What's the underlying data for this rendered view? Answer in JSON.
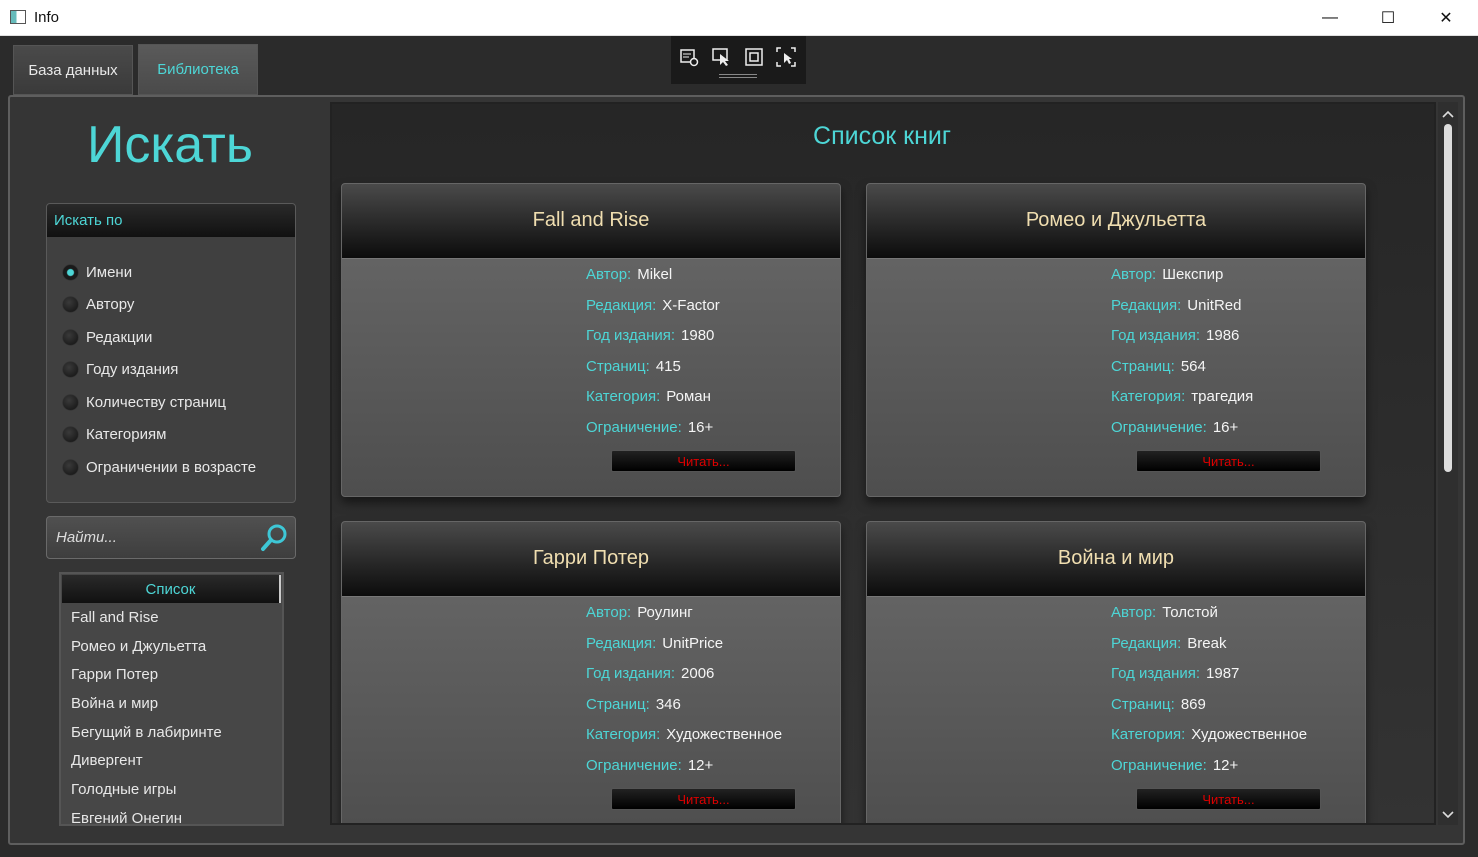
{
  "window": {
    "title": "Info",
    "minimize_glyph": "—",
    "maximize_glyph": "☐",
    "close_glyph": "✕"
  },
  "tabs": [
    {
      "label": "База данных"
    },
    {
      "label": "Библиотека"
    }
  ],
  "debug_toolbar": {
    "icons": [
      "live-tree-icon",
      "select-element-icon",
      "display-layout-adorners-icon",
      "track-focus-icon"
    ]
  },
  "search": {
    "title": "Искать",
    "by_header": "Искать по",
    "options": [
      "Имени",
      "Автору",
      "Редакции",
      "Году издания",
      "Количеству страниц",
      "Категориям",
      "Ограничении в возрасте"
    ],
    "selected_index": 0,
    "placeholder": "Найти..."
  },
  "list": {
    "header": "Список",
    "items": [
      "Fall and Rise",
      "Ромео и Джульетта",
      "Гарри Потер",
      "Война и мир",
      "Бегущий в лабиринте",
      "Дивергент",
      "Голодные игры",
      "Евгений Онегин"
    ]
  },
  "content": {
    "title": "Список книг",
    "field_labels": {
      "author": "Автор:",
      "publisher": "Редакция:",
      "year": "Год издания:",
      "pages": "Страниц:",
      "category": "Категория:",
      "age": "Ограничение:"
    },
    "read_label": "Читать...",
    "books": [
      {
        "title": "Fall and Rise",
        "author": "Mikel",
        "publisher": "X-Factor",
        "year": "1980",
        "pages": "415",
        "category": "Роман",
        "age": "16+"
      },
      {
        "title": "Ромео и Джульетта",
        "author": "Шекспир",
        "publisher": "UnitRed",
        "year": "1986",
        "pages": "564",
        "category": "трагедия",
        "age": "16+"
      },
      {
        "title": "Гарри Потер",
        "author": "Роулинг",
        "publisher": "UnitPrice",
        "year": "2006",
        "pages": "346",
        "category": "Художественное",
        "age": "12+"
      },
      {
        "title": "Война и мир",
        "author": "Толстой",
        "publisher": "Break",
        "year": "1987",
        "pages": "869",
        "category": "Художественное",
        "age": "12+"
      }
    ]
  },
  "colors": {
    "accent": "#4dd6d6",
    "card_title": "#f0deb0",
    "read_button_text": "#dd0000"
  }
}
